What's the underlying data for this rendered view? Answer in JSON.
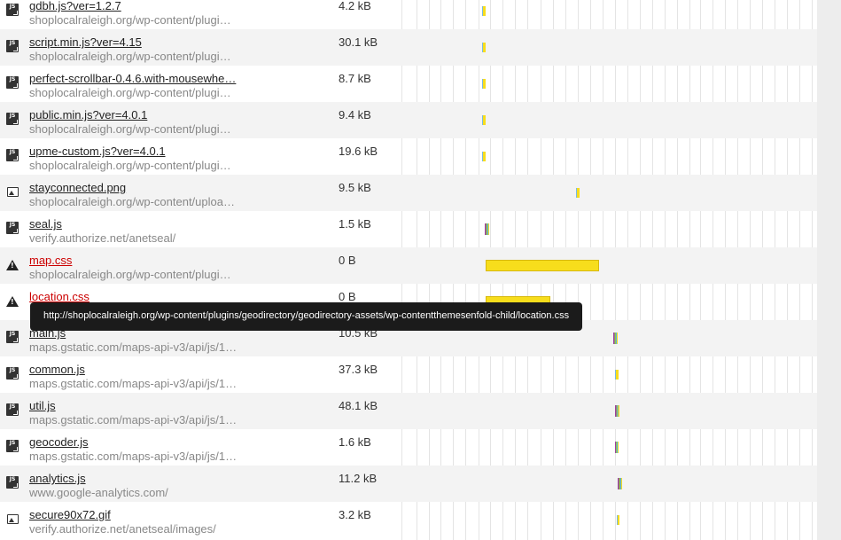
{
  "resources": [
    {
      "name": "gdbh.js?ver=1.2.7",
      "host": "shoplocalraleigh.org/wp-content/plugi…",
      "size": "4.2 kB",
      "type": "js",
      "status": "ok"
    },
    {
      "name": "script.min.js?ver=4.15",
      "host": "shoplocalraleigh.org/wp-content/plugi…",
      "size": "30.1 kB",
      "type": "js",
      "status": "ok"
    },
    {
      "name": "perfect-scrollbar-0.4.6.with-mousewhe…",
      "host": "shoplocalraleigh.org/wp-content/plugi…",
      "size": "8.7 kB",
      "type": "js",
      "status": "ok"
    },
    {
      "name": "public.min.js?ver=4.0.1",
      "host": "shoplocalraleigh.org/wp-content/plugi…",
      "size": "9.4 kB",
      "type": "js",
      "status": "ok"
    },
    {
      "name": "upme-custom.js?ver=4.0.1",
      "host": "shoplocalraleigh.org/wp-content/plugi…",
      "size": "19.6 kB",
      "type": "js",
      "status": "ok"
    },
    {
      "name": "stayconnected.png",
      "host": "shoplocalraleigh.org/wp-content/uploa…",
      "size": "9.5 kB",
      "type": "img",
      "status": "ok"
    },
    {
      "name": "seal.js",
      "host": "verify.authorize.net/anetseal/",
      "size": "1.5 kB",
      "type": "js",
      "status": "ok"
    },
    {
      "name": "map.css",
      "host": "shoplocalraleigh.org/wp-content/plugi…",
      "size": "0 B",
      "type": "warn",
      "status": "error"
    },
    {
      "name": "location.css",
      "host": "",
      "size": "0 B",
      "type": "warn",
      "status": "error"
    },
    {
      "name": "main.js",
      "host": "maps.gstatic.com/maps-api-v3/api/js/1…",
      "size": "10.5 kB",
      "type": "js",
      "status": "ok"
    },
    {
      "name": "common.js",
      "host": "maps.gstatic.com/maps-api-v3/api/js/1…",
      "size": "37.3 kB",
      "type": "js",
      "status": "ok"
    },
    {
      "name": "util.js",
      "host": "maps.gstatic.com/maps-api-v3/api/js/1…",
      "size": "48.1 kB",
      "type": "js",
      "status": "ok"
    },
    {
      "name": "geocoder.js",
      "host": "maps.gstatic.com/maps-api-v3/api/js/1…",
      "size": "1.6 kB",
      "type": "js",
      "status": "ok"
    },
    {
      "name": "analytics.js",
      "host": "www.google-analytics.com/",
      "size": "11.2 kB",
      "type": "js",
      "status": "ok"
    },
    {
      "name": "secure90x72.gif",
      "host": "verify.authorize.net/anetseal/images/",
      "size": "3.2 kB",
      "type": "img",
      "status": "ok"
    }
  ],
  "tooltip": "http://shoplocalraleigh.org/wp-content/plugins/geodirectory/geodirectory-assets/wp-contentthemesenfold-child/location.css",
  "colors": {
    "error": "#cc0000",
    "bar_yellow": "#f7dd1c",
    "tooltip_bg": "#1b1b1b"
  }
}
